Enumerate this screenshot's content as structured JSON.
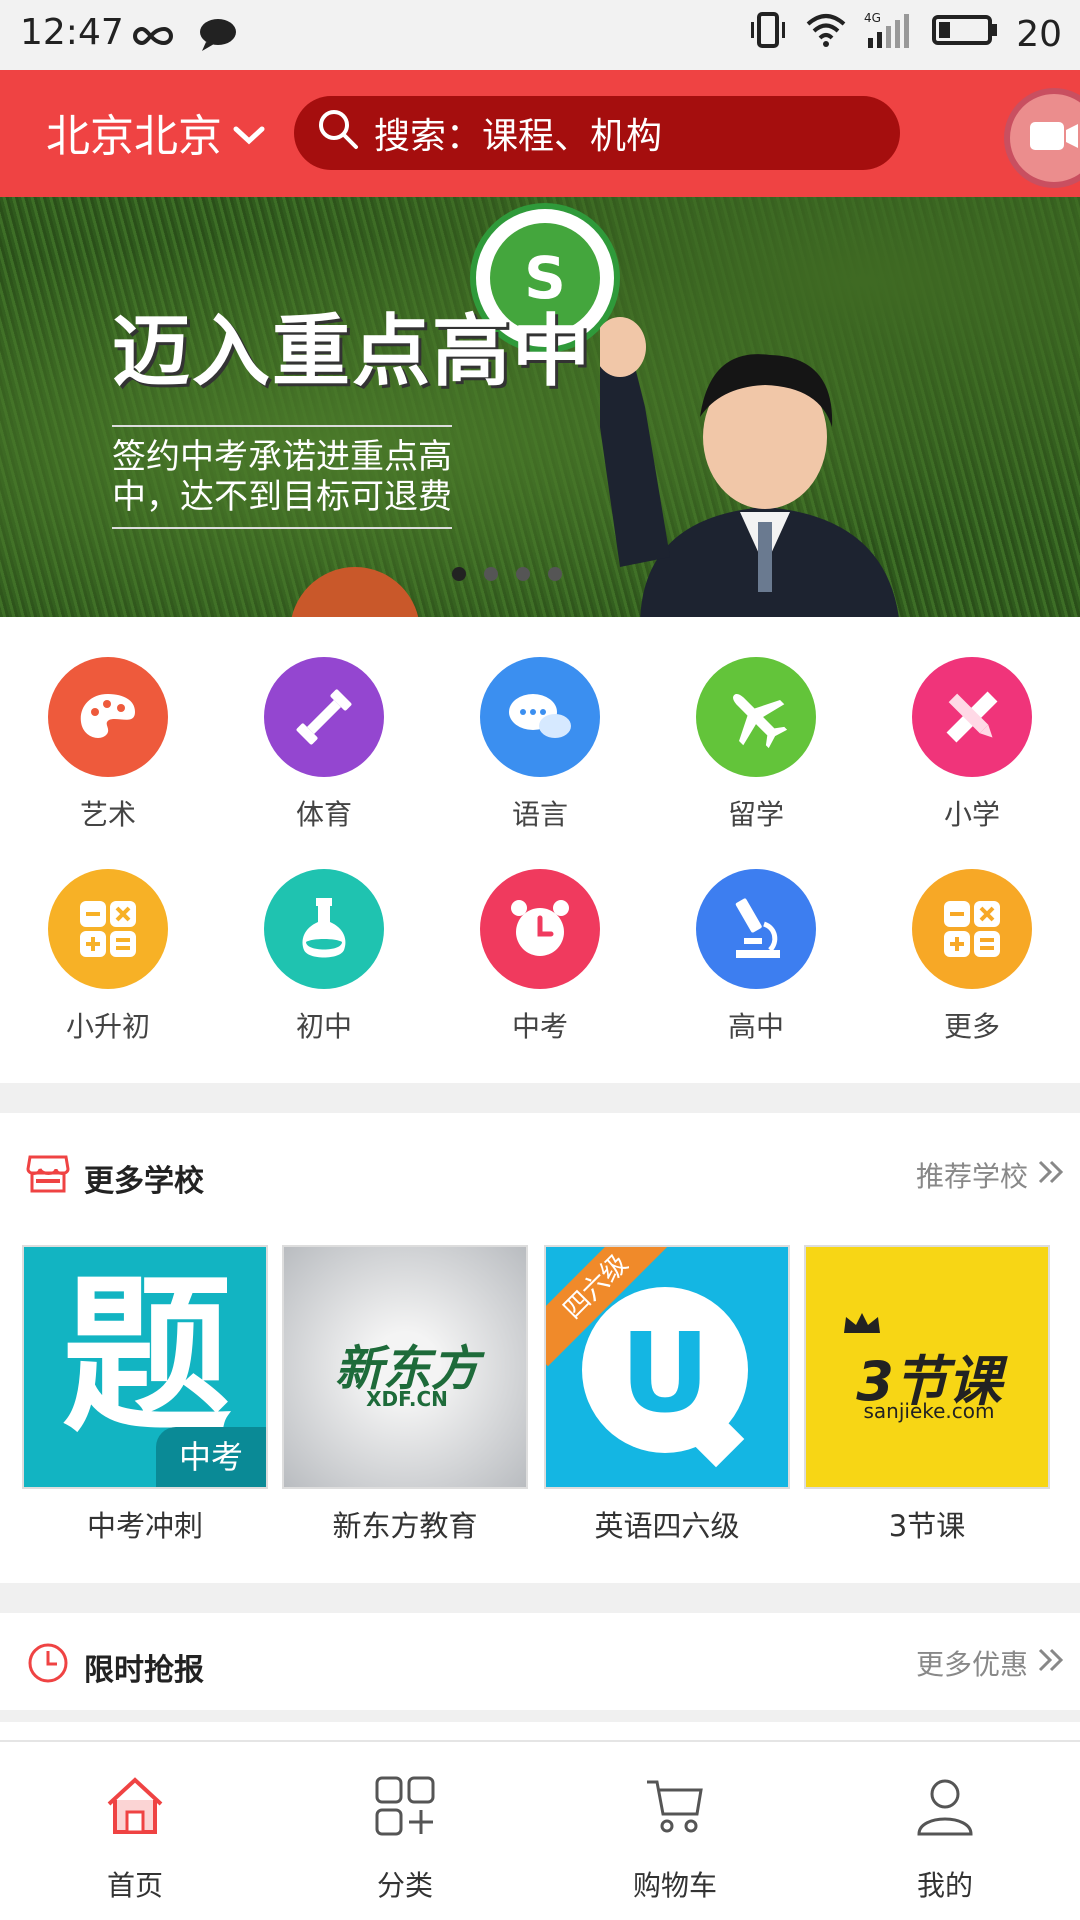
{
  "status_bar": {
    "time": "12:47",
    "battery": "20",
    "network": "4G"
  },
  "header": {
    "city": "北京北京",
    "search_placeholder": "搜索：课程、机构"
  },
  "banner": {
    "slogan": "迈入重点高中",
    "subline": "签约中考承诺进重点高中，达不到目标可退费",
    "logo_letter": "S"
  },
  "categories": [
    {
      "label": "艺术",
      "color": "#ee5a3c",
      "icon": "palette-icon"
    },
    {
      "label": "体育",
      "color": "#9446d0",
      "icon": "dumbbell-icon"
    },
    {
      "label": "语言",
      "color": "#3b8ff0",
      "icon": "chat-icon"
    },
    {
      "label": "留学",
      "color": "#63c43a",
      "icon": "airplane-icon"
    },
    {
      "label": "小学",
      "color": "#f0347a",
      "icon": "pencil-ruler-icon"
    },
    {
      "label": "小升初",
      "color": "#f7b126",
      "icon": "calculator-icon"
    },
    {
      "label": "初中",
      "color": "#1fc3b0",
      "icon": "flask-icon"
    },
    {
      "label": "中考",
      "color": "#f03a5e",
      "icon": "alarm-clock-icon"
    },
    {
      "label": "高中",
      "color": "#3d7ef0",
      "icon": "microscope-icon"
    },
    {
      "label": "更多",
      "color": "#f7a826",
      "icon": "calculator-icon"
    }
  ],
  "schools_section": {
    "title": "更多学校",
    "more": "推荐学校",
    "items": [
      {
        "name": "中考冲刺",
        "thumb_text": "题",
        "badge": "中考"
      },
      {
        "name": "新东方教育",
        "thumb_text": "新东方",
        "sub": "XDF.CN"
      },
      {
        "name": "英语四六级",
        "thumb_text": "U",
        "badge": "四六级"
      },
      {
        "name": "3节课",
        "thumb_text": "3节课",
        "sub": "sanjieke.com"
      }
    ]
  },
  "limited_section": {
    "title": "限时抢报",
    "more": "更多优惠"
  },
  "tabbar": [
    {
      "label": "首页",
      "icon": "home-icon",
      "active": true
    },
    {
      "label": "分类",
      "icon": "grid-plus-icon",
      "active": false
    },
    {
      "label": "购物车",
      "icon": "cart-icon",
      "active": false
    },
    {
      "label": "我的",
      "icon": "user-icon",
      "active": false
    }
  ],
  "colors": {
    "header": "#ef4343",
    "search": "#a50e0e",
    "active_tab": "#ef4343"
  }
}
